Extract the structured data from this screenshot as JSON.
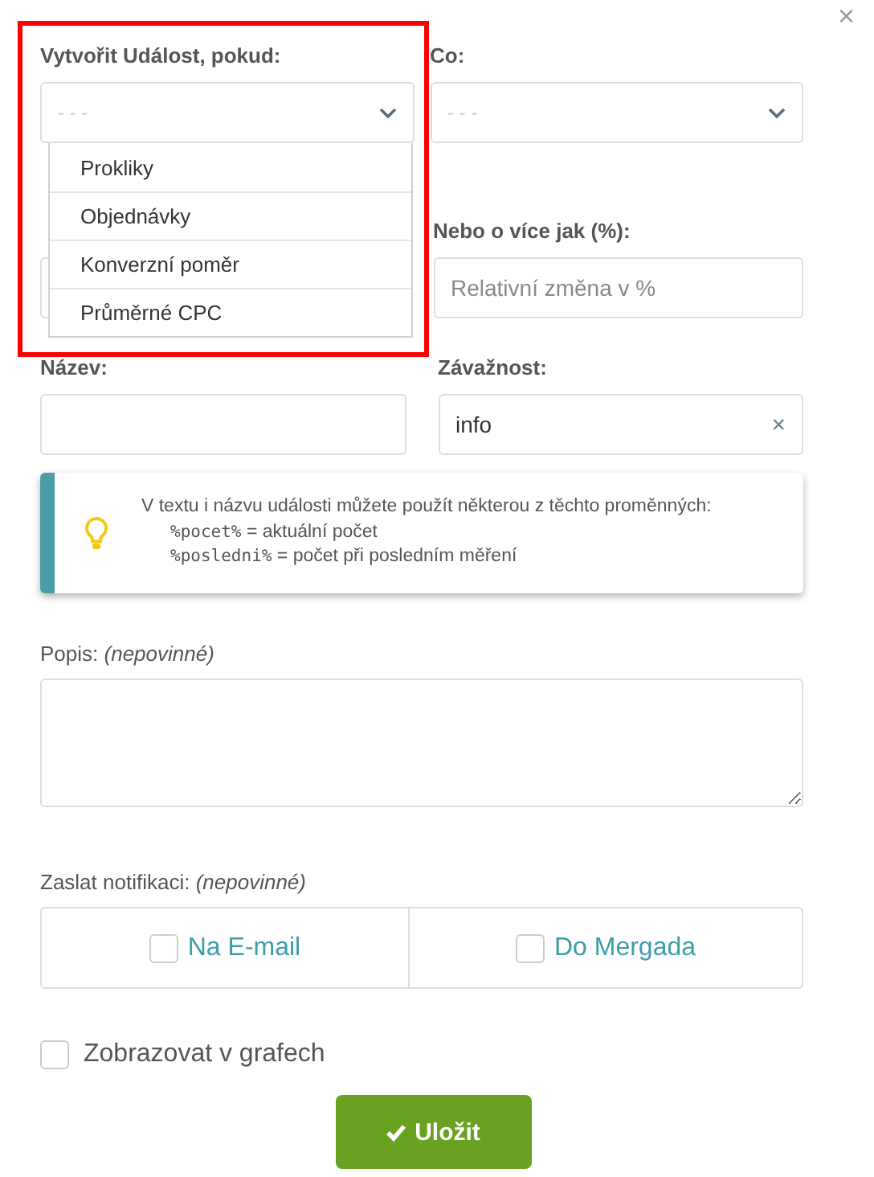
{
  "close": "×",
  "row1": [
    {
      "label": "Vytvořit Událost, pokud:",
      "placeholder": "- - -",
      "options": [
        {
          "label": "Prokliky",
          "selected": false
        },
        {
          "label": "Objednávky",
          "selected": false
        },
        {
          "label": "Konverzní poměr",
          "selected": false
        },
        {
          "label": "Průměrné CPC",
          "selected": false
        }
      ]
    },
    {
      "label": "Co:",
      "placeholder": "- - -"
    }
  ],
  "row2": {
    "label": "Nebo o více jak (%):",
    "placeholder": "Relativní změna v %"
  },
  "row3": [
    {
      "label": "Název:"
    },
    {
      "label": "Závažnost:",
      "value": "info",
      "clear": "×"
    }
  ],
  "info": {
    "text": "V textu i názvu události můžete použít některou z těchto proměnných:",
    "vars": [
      {
        "code": "%pocet%",
        "desc": " = aktuální počet"
      },
      {
        "code": "%posledni%",
        "desc": " = počet při posledním měření"
      }
    ]
  },
  "description": {
    "label": "Popis:",
    "hint": "(nepovinné)"
  },
  "notify": {
    "label": "Zaslat notifikaci:",
    "hint": "(nepovinné)",
    "options": [
      {
        "label": "Na E-mail",
        "checked": false
      },
      {
        "label": "Do Mergada",
        "checked": false
      }
    ]
  },
  "graphs": {
    "label": "Zobrazovat v grafech",
    "checked": false
  },
  "save": "Uložit"
}
